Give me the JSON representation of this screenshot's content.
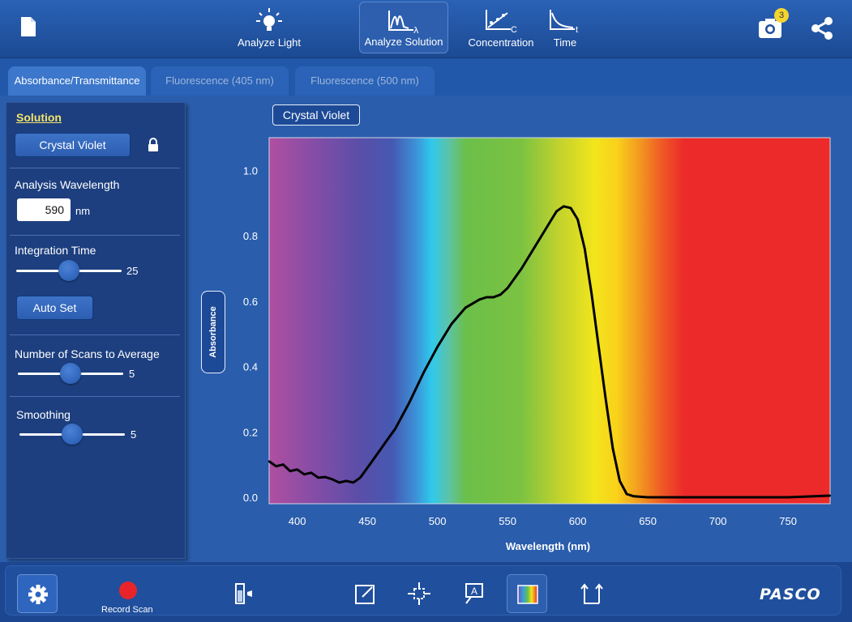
{
  "topbar": {
    "nav": [
      {
        "label": "Analyze Light",
        "icon": "bulb-icon",
        "active": false
      },
      {
        "label": "Analyze Solution",
        "icon": "absorbance-lambda-icon",
        "active": true
      },
      {
        "label": "Concentration",
        "icon": "concentration-icon",
        "active": false
      },
      {
        "label": "Time",
        "icon": "time-icon",
        "active": false
      }
    ],
    "camera_badge": "3"
  },
  "tabs": [
    {
      "label": "Absorbance/Transmittance",
      "active": true
    },
    {
      "label": "Fluorescence (405 nm)",
      "active": false
    },
    {
      "label": "Fluorescence (500 nm)",
      "active": false
    }
  ],
  "panel": {
    "solution_title": "Solution",
    "solution_button": "Crystal Violet",
    "wavelength_label": "Analysis Wavelength",
    "wavelength_value": "590",
    "wavelength_unit": "nm",
    "integration_label": "Integration Time",
    "integration_value": "25",
    "integration_fraction": 0.5,
    "auto_set": "Auto Set",
    "scans_label": "Number of Scans to Average",
    "scans_value": "5",
    "scans_fraction": 0.5,
    "smoothing_label": "Smoothing",
    "smoothing_value": "5",
    "smoothing_fraction": 0.5
  },
  "chart_tag": "Crystal Violet",
  "chart_data": {
    "type": "line",
    "ylabel": "Absorbance",
    "xlabel": "Wavelength (nm)",
    "xlim": [
      380,
      780
    ],
    "ylim": [
      0,
      1.1
    ],
    "x_ticks": [
      400,
      450,
      500,
      550,
      600,
      650,
      700,
      750
    ],
    "y_ticks": [
      "0.0",
      "0.2",
      "0.4",
      "0.6",
      "0.8",
      "1.0"
    ],
    "background": "visible spectrum gradient",
    "series": [
      {
        "color": "#000000",
        "x": [
          380,
          385,
          390,
          395,
          400,
          405,
          410,
          415,
          420,
          425,
          430,
          435,
          440,
          445,
          450,
          455,
          460,
          465,
          470,
          480,
          490,
          500,
          510,
          520,
          530,
          535,
          540,
          545,
          550,
          560,
          570,
          580,
          585,
          590,
          595,
          600,
          605,
          610,
          615,
          620,
          625,
          630,
          635,
          640,
          650,
          700,
          750,
          780
        ],
        "y": [
          0.11,
          0.095,
          0.1,
          0.08,
          0.085,
          0.07,
          0.075,
          0.06,
          0.062,
          0.055,
          0.045,
          0.05,
          0.045,
          0.06,
          0.09,
          0.12,
          0.15,
          0.18,
          0.21,
          0.29,
          0.38,
          0.46,
          0.53,
          0.58,
          0.605,
          0.612,
          0.612,
          0.62,
          0.64,
          0.7,
          0.77,
          0.84,
          0.875,
          0.89,
          0.885,
          0.85,
          0.76,
          0.62,
          0.46,
          0.3,
          0.15,
          0.05,
          0.01,
          0.003,
          0.0,
          0.0,
          0.0,
          0.005
        ]
      }
    ]
  },
  "bottom": {
    "record_label": "Record Scan",
    "logo": "PASCO"
  }
}
